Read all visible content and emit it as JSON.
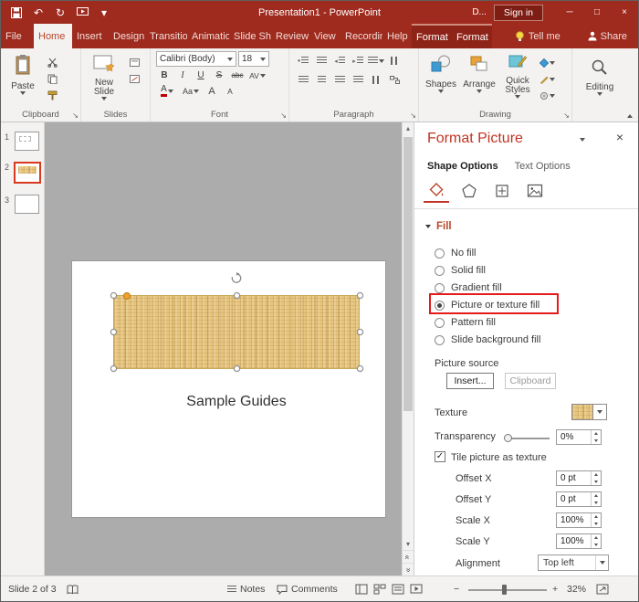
{
  "colors": {
    "titlebar_red": "#9F2B1F",
    "contextual_tab_red": "#8E2318",
    "accent_red": "#B7472A",
    "pane_title_red": "#C13524",
    "annotation_red": "#E41B1B",
    "selection_orange": "#D8391F",
    "texture_tan": "#E7C57E"
  },
  "icons": {
    "chevron_down": "▾",
    "chevron_up": "▴",
    "undo": "↶",
    "redo": "↻",
    "minimize": "─",
    "maximize": "□",
    "close": "×",
    "check": "✓",
    "launcher": "↘",
    "double_chevron": "«",
    "zoom_minus": "−",
    "zoom_plus": "+"
  },
  "titlebar": {
    "title": "Presentation1 - PowerPoint",
    "user_label": "D...",
    "sign_in_label": "Sign in"
  },
  "tabs": {
    "file": "File",
    "main": [
      "Home",
      "Insert",
      "Design",
      "Transitions",
      "Animations",
      "Slide Show",
      "Review",
      "View",
      "Recording",
      "Help"
    ],
    "contextual": [
      "Format",
      "Format"
    ],
    "tell_me": "Tell me",
    "share": "Share"
  },
  "ribbon": {
    "clipboard": {
      "label": "Clipboard",
      "paste": "Paste"
    },
    "slides": {
      "label": "Slides",
      "new_slide": "New Slide"
    },
    "font": {
      "label": "Font",
      "font_name": "Calibri (Body)",
      "font_size": "18",
      "bold": "B",
      "italic": "I",
      "underline": "U",
      "strike": "S",
      "strike_abc": "abc",
      "spacing": "AV",
      "font_color": "A",
      "change_case": "Aa",
      "grow": "A",
      "shrink": "A"
    },
    "paragraph": {
      "label": "Paragraph"
    },
    "drawing": {
      "label": "Drawing",
      "shapes": "Shapes",
      "arrange": "Arrange",
      "quick_styles": "Quick Styles"
    },
    "editing": {
      "label": "Editing"
    }
  },
  "thumbnails": [
    {
      "number": "1"
    },
    {
      "number": "2"
    },
    {
      "number": "3"
    }
  ],
  "slide": {
    "caption": "Sample Guides"
  },
  "pane": {
    "title": "Format Picture",
    "tab_shape": "Shape Options",
    "tab_text": "Text Options",
    "section_fill": "Fill",
    "fill_options": [
      "No fill",
      "Solid fill",
      "Gradient fill",
      "Picture or texture fill",
      "Pattern fill",
      "Slide background fill"
    ],
    "selected_fill_option": "Picture or texture fill",
    "picture_source_label": "Picture source",
    "insert_button": "Insert...",
    "clipboard_button": "Clipboard",
    "texture_label": "Texture",
    "transparency_label": "Transparency",
    "transparency_value": "0%",
    "tile_checkbox_label": "Tile picture as texture",
    "offset_x_label": "Offset X",
    "offset_x_value": "0 pt",
    "offset_y_label": "Offset Y",
    "offset_y_value": "0 pt",
    "scale_x_label": "Scale X",
    "scale_x_value": "100%",
    "scale_y_label": "Scale Y",
    "scale_y_value": "100%",
    "alignment_label": "Alignment",
    "alignment_value": "Top left"
  },
  "statusbar": {
    "slide_info": "Slide 2 of 3",
    "notes_label": "Notes",
    "comments_label": "Comments",
    "zoom_value": "32%"
  }
}
